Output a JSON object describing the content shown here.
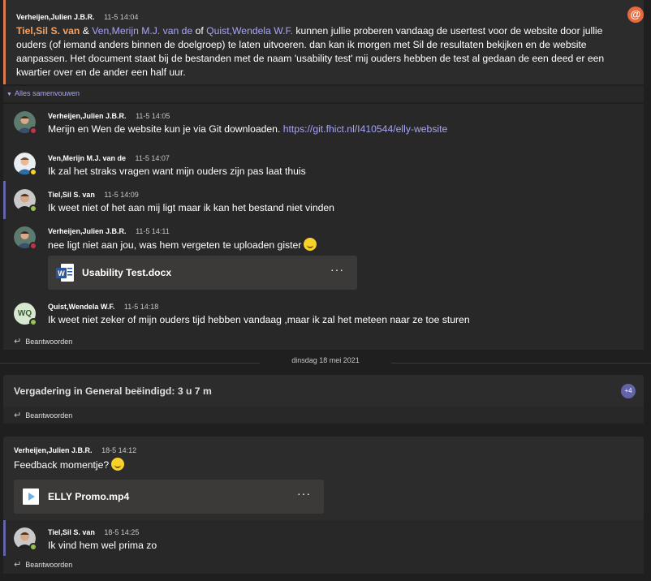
{
  "first_post": {
    "author": "Verheijen,Julien J.B.R.",
    "time": "11-5 14:04",
    "mention1": "Tiel,Sil S. van",
    "amp": " & ",
    "mention2": "Ven,Merijn M.J. van de",
    "of": " of ",
    "mention3": "Quist,Wendela W.F.",
    "text": " kunnen jullie proberen vandaag de usertest voor de website door jullie ouders (of iemand anders binnen de doelgroep) te laten uitvoeren. dan kan ik morgen met Sil de resultaten bekijken en de website aanpassen. Het document staat bij de bestanden met de naam 'usability test'  mij ouders hebben de test al gedaan de een deed er een kwartier over en de ander een half uur.",
    "mention_badge": "@"
  },
  "collapse_label": "Alles samenvouwen",
  "replies": [
    {
      "author": "Verheijen,Julien J.B.R.",
      "time": "11-5 14:05",
      "text": "Merijn en Wen de website kun je via Git downloaden. ",
      "link": "https://git.fhict.nl/I410544/elly-website"
    },
    {
      "author": "Ven,Merijn M.J. van de",
      "time": "11-5 14:07",
      "text": "Ik zal het straks vragen want mijn ouders zijn pas laat thuis"
    },
    {
      "author": "Tiel,Sil S. van",
      "time": "11-5 14:09",
      "text": "Ik weet niet of het aan mij ligt maar ik kan het bestand niet vinden"
    },
    {
      "author": "Verheijen,Julien J.B.R.",
      "time": "11-5 14:11",
      "text": "nee ligt niet aan jou, was hem vergeten te uploaden gister"
    },
    {
      "author": "Quist,Wendela W.F.",
      "time": "11-5 14:18",
      "text": "Ik weet niet zeker of mijn ouders tijd hebben vandaag ,maar ik zal het meteen naar ze toe sturen",
      "initials": "WQ"
    }
  ],
  "file1": {
    "name": "Usability Test.docx",
    "more": "···"
  },
  "reply_label": "Beantwoorden",
  "date_divider": "dinsdag 18 mei 2021",
  "meeting": {
    "title": "Vergadering in General beëindigd: 3 u 7 m",
    "badge": "+4"
  },
  "post2": {
    "author": "Verheijen,Julien J.B.R.",
    "time": "18-5 14:12",
    "text": "Feedback momentje?"
  },
  "file2": {
    "name": "ELLY Promo.mp4",
    "more": "···"
  },
  "post2_reply": {
    "author": "Tiel,Sil S. van",
    "time": "18-5 14:25",
    "text": "Ik vind hem wel prima zo"
  },
  "colors": {
    "accent": "#6264a7",
    "mention": "#f4a261",
    "link": "#a7a5f5"
  }
}
